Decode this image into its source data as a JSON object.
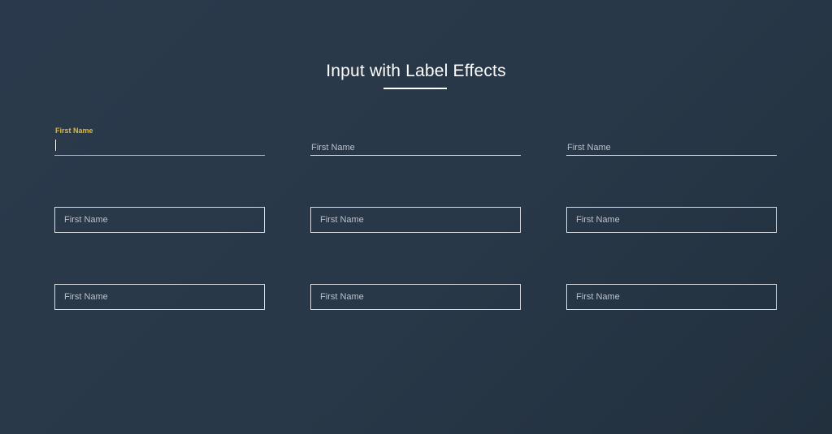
{
  "header": {
    "title": "Input with Label Effects"
  },
  "colors": {
    "background": "#283848",
    "accent": "#e8b920",
    "border": "#d8dde3",
    "label": "#b9c0c8"
  },
  "row1": {
    "field1": {
      "label": "First Name",
      "state": "focused",
      "value": ""
    },
    "field2": {
      "label": "First Name",
      "value": ""
    },
    "field3": {
      "label": "First Name",
      "value": ""
    }
  },
  "row2": {
    "field1": {
      "label": "First Name",
      "value": ""
    },
    "field2": {
      "label": "First Name",
      "value": ""
    },
    "field3": {
      "label": "First Name",
      "value": ""
    }
  },
  "row3": {
    "field1": {
      "label": "First Name",
      "value": ""
    },
    "field2": {
      "label": "First Name",
      "value": ""
    },
    "field3": {
      "label": "First Name",
      "value": ""
    }
  }
}
